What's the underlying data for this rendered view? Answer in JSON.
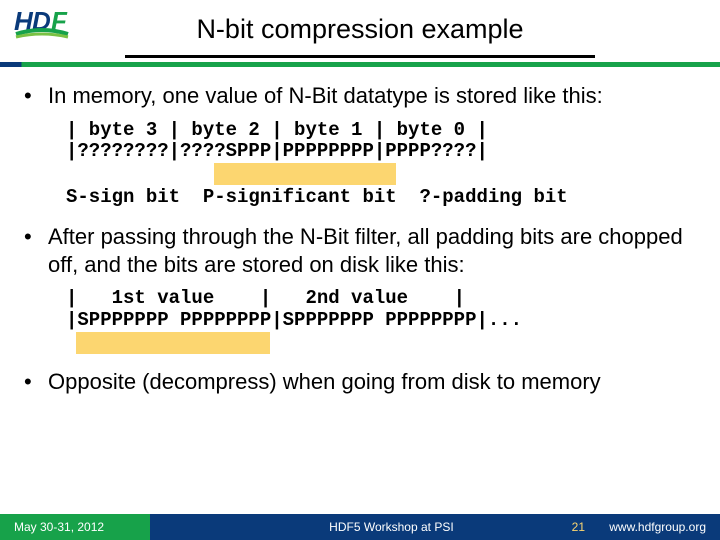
{
  "header": {
    "title": "N-bit compression example"
  },
  "bullets": {
    "b1": "In memory, one value of N-Bit datatype is stored like this:",
    "b2": "After passing through the N-Bit filter, all padding bits are chopped off, and the bits are stored on disk like this:",
    "b3": "Opposite (decompress) when going from disk to memory"
  },
  "code1": {
    "line1": "| byte 3 | byte 2 | byte 1 | byte 0 |",
    "line2": "|????????|????SPPP|PPPPPPPP|PPPP????|",
    "legend": "S-sign bit  P-significant bit  ?-padding bit"
  },
  "code2": {
    "line1": "|   1st value    |   2nd value    |",
    "line2": "|SPPPPPPP PPPPPPPP|SPPPPPPP PPPPPPPP|..."
  },
  "footer": {
    "date": "May 30-31, 2012",
    "center": "HDF5 Workshop at PSI",
    "page": "21",
    "url": "www.hdfgroup.org"
  }
}
